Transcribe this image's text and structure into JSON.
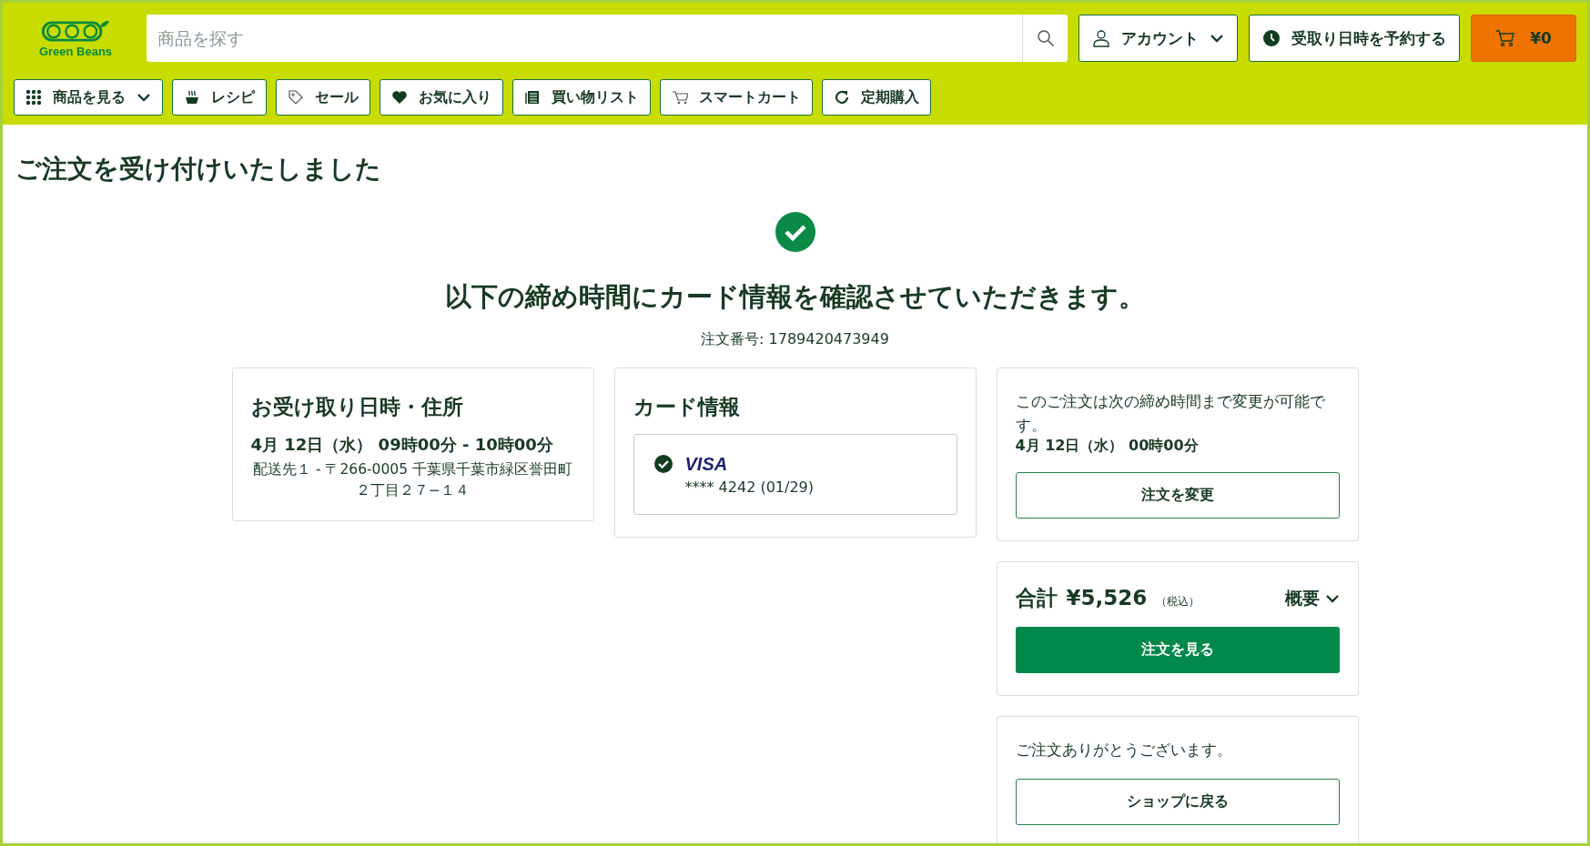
{
  "header": {
    "logo_text": "Green Beans",
    "search": {
      "placeholder": "商品を探す"
    },
    "account": {
      "label": "アカウント",
      "dropdown": true
    },
    "reserve": {
      "label": "受取り日時を予約する"
    },
    "cart": {
      "amount": "¥0"
    }
  },
  "nav": [
    {
      "label": "商品を見る",
      "dropdown": true
    },
    {
      "label": "レシピ",
      "dropdown": false
    },
    {
      "label": "セール",
      "dropdown": false
    },
    {
      "label": "お気に入り",
      "dropdown": false
    },
    {
      "label": "買い物リスト",
      "dropdown": false
    },
    {
      "label": "スマートカート",
      "dropdown": false
    },
    {
      "label": "定期購入",
      "dropdown": false
    }
  ],
  "page": {
    "title": "ご注文を受け付けいたしました",
    "heading": "以下の締め時間にカード情報を確認させていただきます。",
    "order_number": "注文番号: 1789420473949"
  },
  "pickup": {
    "title": "お受け取り日時・住所",
    "datetime": "4月 12日（水） 09時00分 - 10時00分",
    "address": "配送先１ -  〒266-0005 千葉県千葉市緑区誉田町２丁目２７−１４"
  },
  "payment": {
    "title": "カード情報",
    "cards": [
      {
        "brand": "VISA",
        "number": "**** 4242 (01/29)",
        "selected": true
      }
    ]
  },
  "change": {
    "note": "このご注文は次の締め時間まで変更が可能です。",
    "deadline": "4月 12日（水） 00時00分",
    "button": "注文を変更"
  },
  "total": {
    "label": "合計",
    "amount": "¥5,526",
    "tax": "（税込）",
    "summary": "概要",
    "button": "注文を見る"
  },
  "thanks": {
    "text": "ご注文ありがとうございます。",
    "button": "ショップに戻る"
  }
}
